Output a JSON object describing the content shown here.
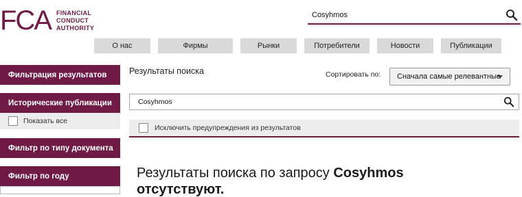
{
  "header": {
    "logo_mark": "FCA",
    "logo_lines": [
      "FINANCIAL",
      "CONDUCT",
      "AUTHORITY"
    ],
    "search_value": "Cosyhmos"
  },
  "nav": {
    "items": [
      {
        "label": "О нас",
        "width": 82
      },
      {
        "label": "Фирмы",
        "width": 109
      },
      {
        "label": "Рынки",
        "width": 82
      },
      {
        "label": "Потребители",
        "width": 95
      },
      {
        "label": "Новости",
        "width": 82
      },
      {
        "label": "Публикации",
        "width": 88
      }
    ]
  },
  "sidebar": {
    "filter_results": "Фильтрация результатов",
    "historic": "Исторические публикации",
    "show_all": "Показать все",
    "doc_type": "Фильтр по типу документа",
    "year": "Фильтр по году"
  },
  "main": {
    "title": "Результаты поиска",
    "sort_label": "Сортировать по:",
    "sort_value": "Сначала самые релевантные",
    "search_value": "Cosyhmos",
    "exclude_label": "Исключить предупреждения из результатов",
    "no_results_prefix": "Результаты поиска по запросу ",
    "no_results_query": "Cosyhmos",
    "no_results_suffix": " отсутствуют."
  },
  "colors": {
    "brand": "#701b45",
    "nav_bg": "#d9d9d9",
    "panel_bg": "#ececec"
  },
  "icons": {
    "search": "search-icon",
    "chevron": "chevron-down-icon",
    "checkbox": "checkbox-icon"
  }
}
